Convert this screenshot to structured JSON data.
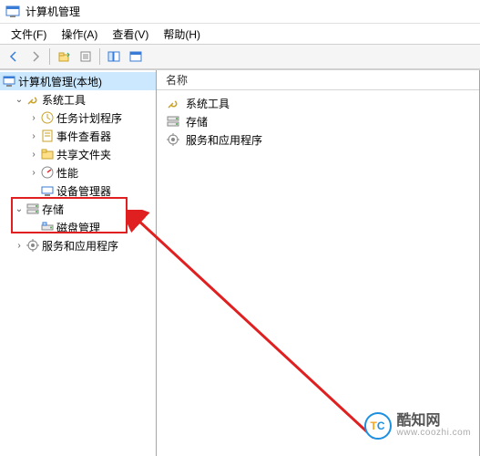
{
  "title": "计算机管理",
  "menu": {
    "file": "文件(F)",
    "action": "操作(A)",
    "view": "查看(V)",
    "help": "帮助(H)"
  },
  "tree": {
    "root": "计算机管理(本地)",
    "system_tools": "系统工具",
    "task_scheduler": "任务计划程序",
    "event_viewer": "事件查看器",
    "shared_folders": "共享文件夹",
    "performance": "性能",
    "device_manager": "设备管理器",
    "storage": "存储",
    "disk_management": "磁盘管理",
    "services_apps": "服务和应用程序"
  },
  "list": {
    "header_name": "名称",
    "items": {
      "system_tools": "系统工具",
      "storage": "存储",
      "services_apps": "服务和应用程序"
    }
  },
  "watermark": {
    "name": "酷知网",
    "url": "www.coozhi.com"
  }
}
